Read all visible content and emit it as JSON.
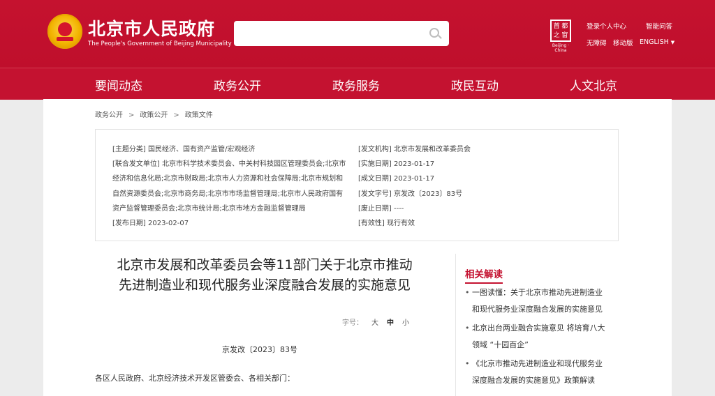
{
  "header": {
    "site_title": "北京市人民政府",
    "site_subtitle": "The People's Government of Beijing Municipality",
    "search_placeholder": "",
    "capital_logo_text": "首 都 之 窗",
    "capital_logo_sub": "Beijing · China",
    "links": {
      "login": "登录个人中心",
      "help": "智能问答",
      "accessibility": "无障碍",
      "mobile": "移动版",
      "language": "ENGLISH"
    }
  },
  "nav": {
    "items": [
      "要闻动态",
      "政务公开",
      "政务服务",
      "政民互动",
      "人文北京"
    ]
  },
  "breadcrumb": [
    "政务公开",
    "政策公开",
    "政策文件"
  ],
  "info": {
    "left": [
      "[主题分类] 国民经济、国有资产监管/宏观经济",
      "[联合发文单位] 北京市科学技术委员会、中关村科技园区管理委员会;北京市",
      "经济和信息化局;北京市财政局;北京市人力资源和社会保障局;北京市规划和",
      "自然资源委员会;北京市商务局;北京市市场监督管理局;北京市人民政府国有",
      "资产监督管理委员会;北京市统计局;北京市地方金融监督管理局",
      "[发布日期] 2023-02-07"
    ],
    "right": [
      "[发文机构] 北京市发展和改革委员会",
      "[实施日期] 2023-01-17",
      "[成文日期] 2023-01-17",
      "[发文字号] 京发改〔2023〕83号",
      "[废止日期] ----",
      "[有效性] 现行有效"
    ]
  },
  "document": {
    "title_line1": "北京市发展和改革委员会等11部门关于北京市推动",
    "title_line2": "先进制造业和现代服务业深度融合发展的实施意见",
    "font_size_label": "字号：",
    "font_sizes": [
      "大",
      "中",
      "小"
    ],
    "number": "京发改〔2023〕83号",
    "addressee": "各区人民政府、北京经济技术开发区管委会、各相关部门："
  },
  "related": {
    "title": "相关解读",
    "items": [
      {
        "line1": "一图读懂：关于北京市推动先进制造业",
        "line2": "和现代服务业深度融合发展的实施意见"
      },
      {
        "line1": "北京出台两业融合实施意见 将培育八大",
        "line2": "领域 “十园百企”"
      },
      {
        "line1": "《北京市推动先进制造业和现代服务业",
        "line2": "深度融合发展的实施意见》政策解读"
      }
    ]
  },
  "colors": {
    "brand_red": "#c41230",
    "page_bg": "#ececec"
  }
}
